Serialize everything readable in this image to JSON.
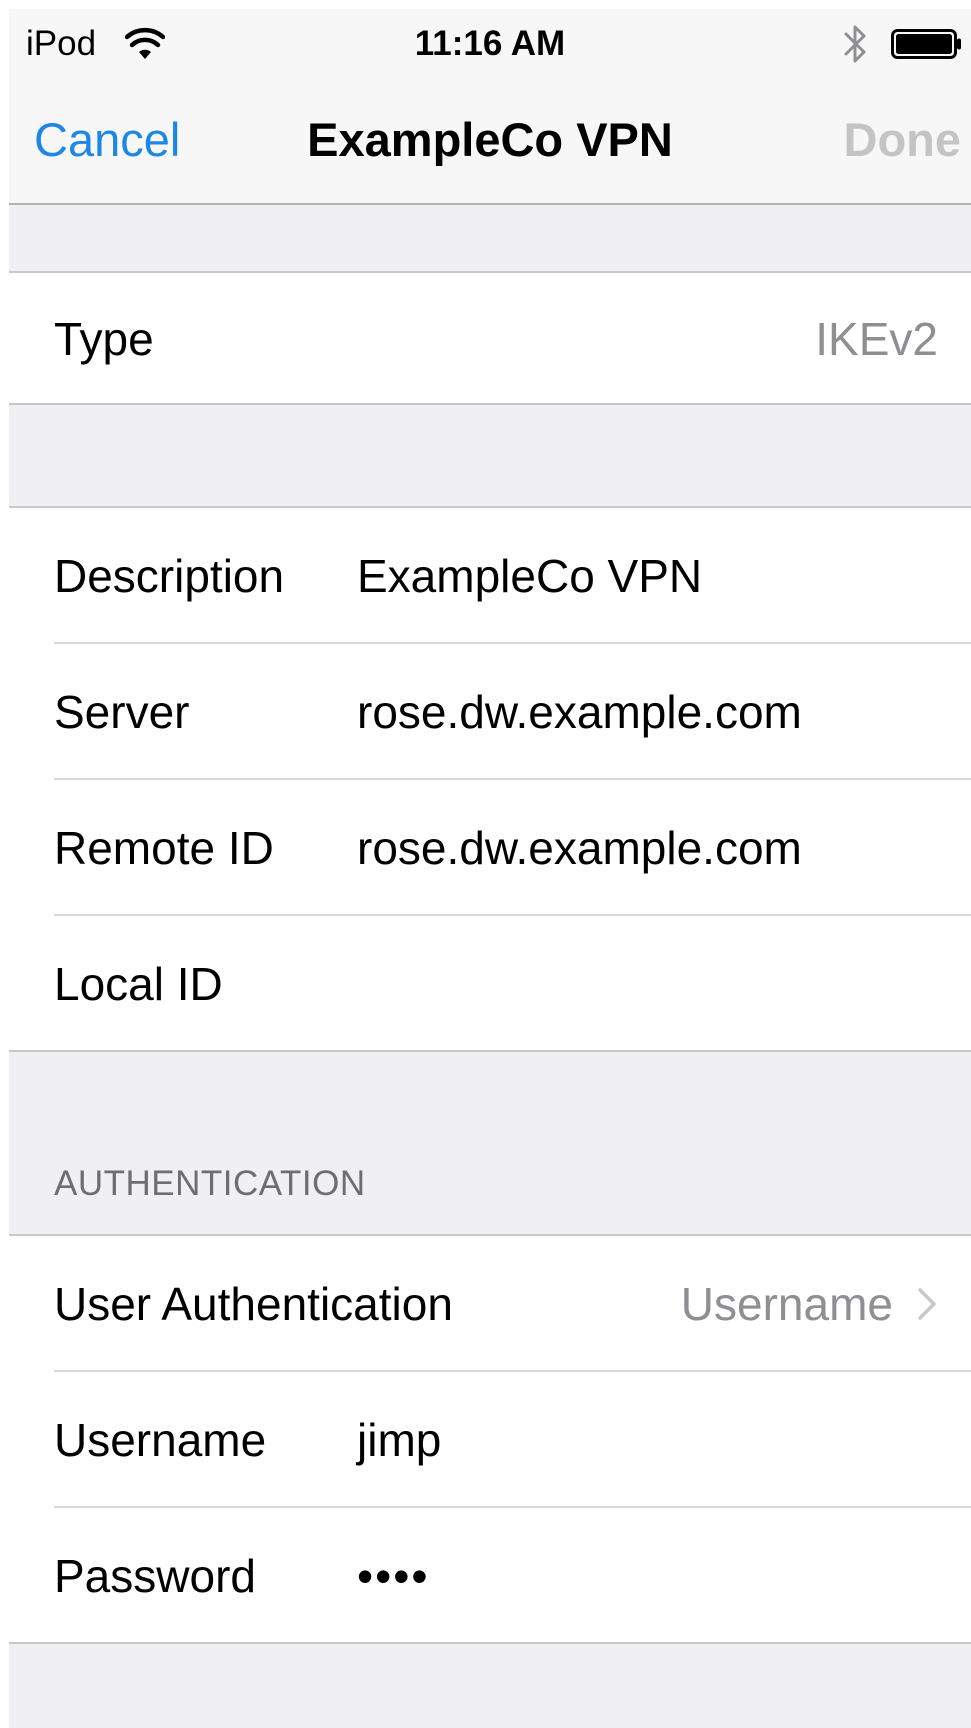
{
  "status_bar": {
    "carrier": "iPod",
    "time": "11:16 AM",
    "wifi_icon": "wifi-icon",
    "bluetooth_icon": "bluetooth-icon",
    "battery_icon": "battery-icon",
    "battery_level": 1.0
  },
  "nav": {
    "cancel": "Cancel",
    "title": "ExampleCo VPN",
    "done": "Done"
  },
  "type_group": {
    "label": "Type",
    "value": "IKEv2"
  },
  "details": {
    "description_label": "Description",
    "description_value": "ExampleCo VPN",
    "server_label": "Server",
    "server_value": "rose.dw.example.com",
    "remote_id_label": "Remote ID",
    "remote_id_value": "rose.dw.example.com",
    "local_id_label": "Local ID",
    "local_id_value": ""
  },
  "authentication": {
    "header": "AUTHENTICATION",
    "user_auth_label": "User Authentication",
    "user_auth_value": "Username",
    "username_label": "Username",
    "username_value": "jimp",
    "password_label": "Password",
    "password_value": "••••"
  },
  "colors": {
    "accent": "#1e87e6",
    "disabled": "#c4c4c7",
    "secondary_text": "#8e8e93",
    "group_background": "#efeff4"
  }
}
